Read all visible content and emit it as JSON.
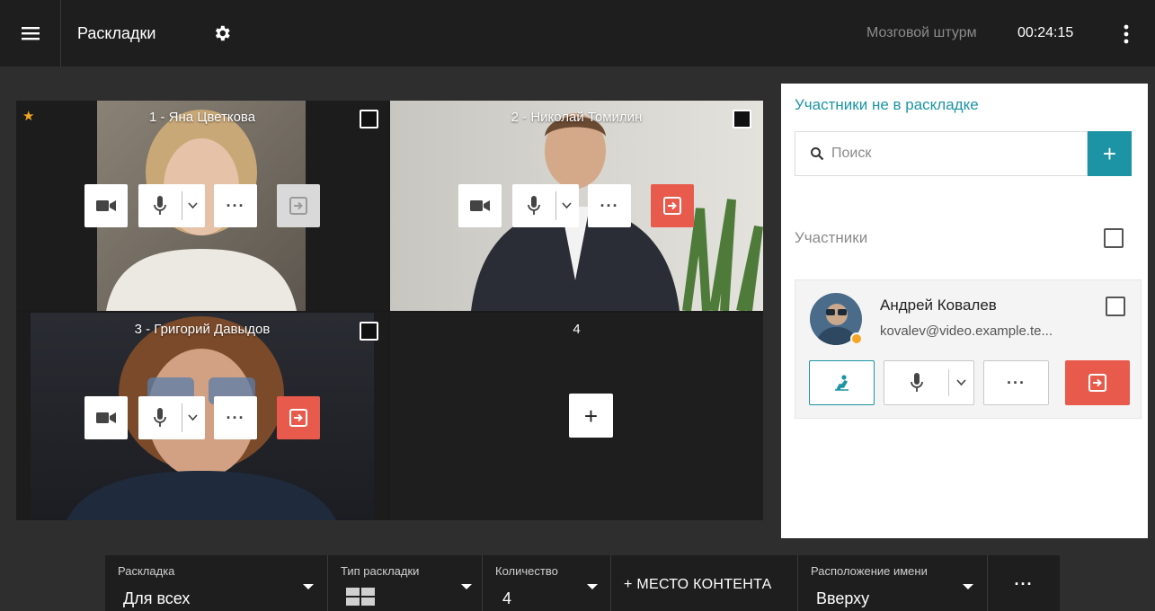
{
  "topbar": {
    "title": "Раскладки",
    "conference_name": "Мозговой штурм",
    "timer": "00:24:15"
  },
  "grid": {
    "cells": [
      {
        "title": "1 - Яна Цветкова",
        "starred": true,
        "leave_enabled": false
      },
      {
        "title": "2 - Николай Томилин",
        "starred": false,
        "leave_enabled": true
      },
      {
        "title": "3 - Григорий Давыдов",
        "starred": false,
        "leave_enabled": true
      },
      {
        "title": "4",
        "empty": true,
        "add_label": "+"
      }
    ]
  },
  "panel": {
    "title": "Участники не в раскладке",
    "search_placeholder": "Поиск",
    "add_label": "+",
    "section_label": "Участники",
    "participant": {
      "name": "Андрей Ковалев",
      "email": "kovalev@video.example.te..."
    }
  },
  "bottombar": {
    "layout_label": "Раскладка",
    "layout_value": "Для всех",
    "layout_type_label": "Тип раскладки",
    "count_label": "Количество",
    "count_value": "4",
    "content_place": "+  МЕСТО КОНТЕНТА",
    "name_position_label": "Расположение имени",
    "name_position_value": "Вверху",
    "more": "···"
  },
  "colors": {
    "accent": "#1c94a5",
    "danger": "#e85b4c",
    "star": "#f5a623",
    "topbar_bg": "#1e1e1e",
    "page_bg": "#2e2e2e"
  },
  "icons": [
    "menu-icon",
    "gear-icon",
    "more-vertical-icon",
    "star-icon",
    "camera-icon",
    "microphone-icon",
    "chevron-down-icon",
    "more-icon",
    "leave-icon",
    "plus-icon",
    "search-icon",
    "raise-hand-icon",
    "layout-grid-icon"
  ]
}
